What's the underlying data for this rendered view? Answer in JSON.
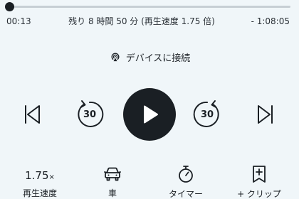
{
  "progress": {
    "elapsed": "00:13",
    "remaining_text": "残り 8 時間 50 分 (再生速度 1.75 倍)",
    "remaining_time": "- 1:08:05",
    "fraction": 0.005
  },
  "connect": {
    "label": "デバイスに接続",
    "icon": "cast-audio-icon"
  },
  "controls": {
    "prev_icon": "skip-previous-icon",
    "back_seconds": "30",
    "play_icon": "play-icon",
    "forward_seconds": "30",
    "next_icon": "skip-next-icon"
  },
  "bottom": {
    "speed": {
      "value": "1.75",
      "suffix": "×",
      "label": "再生速度"
    },
    "car": {
      "icon": "car-icon",
      "label": "車"
    },
    "timer": {
      "icon": "stopwatch-icon",
      "label": "タイマー"
    },
    "clip": {
      "icon": "bookmark-plus-icon",
      "label": "+ クリップ"
    }
  },
  "colors": {
    "background": "#f0f6f9",
    "foreground": "#1a1f24",
    "track": "#c7cfd4"
  }
}
